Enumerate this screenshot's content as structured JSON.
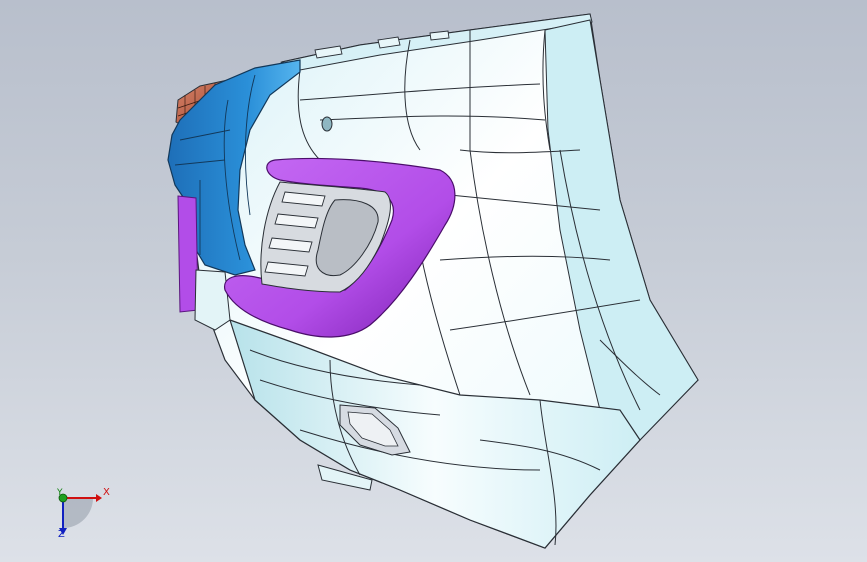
{
  "viewport": {
    "background_top": "#b8bfcc",
    "background_bottom": "#dde1e8"
  },
  "model": {
    "colors": {
      "bumper_body": "#e4f7fb",
      "bumper_shade": "#a8dce6",
      "bracket_blue": "#2a8fd8",
      "bracket_blue_dark": "#1e6fb8",
      "fog_bezel": "#b24de8",
      "fog_bezel_dark": "#7a1fb0",
      "lamp_orange": "#b85a3a",
      "panel_edge": "#2a2f36"
    }
  },
  "triad": {
    "x_label": "X",
    "y_label": "Y",
    "z_label": "Z",
    "x_color": "#d01010",
    "y_color": "#108010",
    "z_color": "#1020c0",
    "icon": "coordinate-triad-icon"
  }
}
